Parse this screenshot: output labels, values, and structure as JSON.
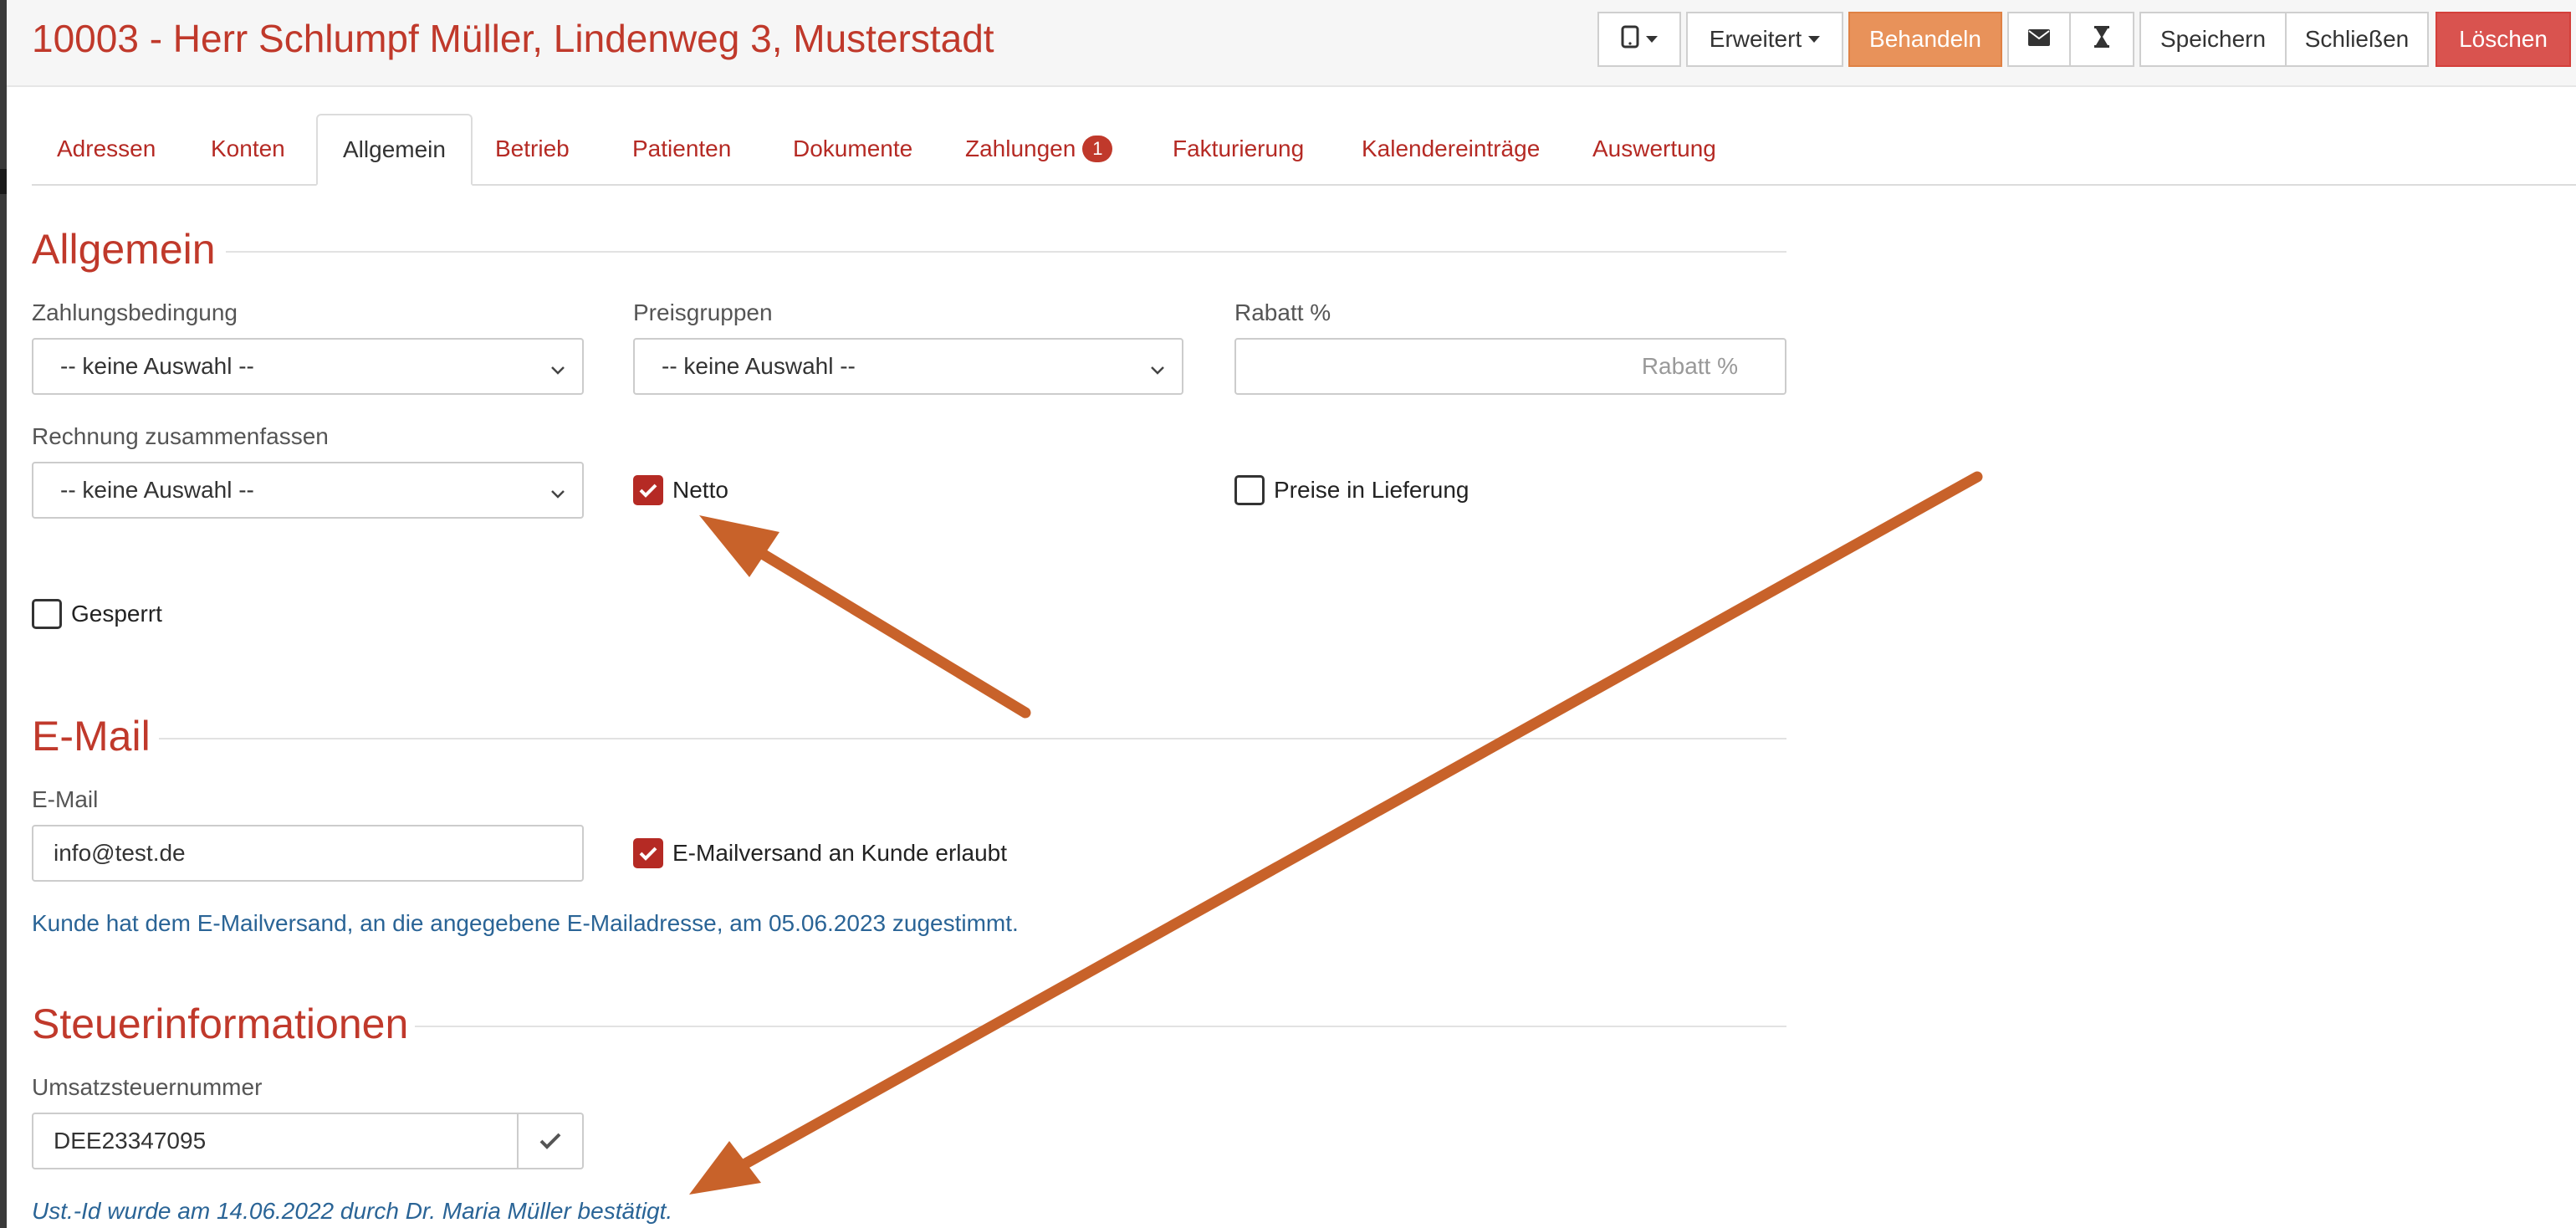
{
  "header": {
    "title": "10003 - Herr Schlumpf Müller, Lindenweg 3, Musterstadt",
    "buttons": {
      "device_icon": "tablet-icon",
      "erweitert": "Erweitert",
      "behandeln": "Behandeln",
      "mail_icon": "envelope-icon",
      "hourglass_icon": "hourglass-icon",
      "speichern": "Speichern",
      "schliessen": "Schließen",
      "loeschen": "Löschen"
    }
  },
  "tabs": [
    {
      "label": "Adressen"
    },
    {
      "label": "Konten"
    },
    {
      "label": "Allgemein",
      "active": true
    },
    {
      "label": "Betrieb"
    },
    {
      "label": "Patienten"
    },
    {
      "label": "Dokumente"
    },
    {
      "label": "Zahlungen",
      "badge": "1"
    },
    {
      "label": "Fakturierung"
    },
    {
      "label": "Kalendereinträge"
    },
    {
      "label": "Auswertung"
    }
  ],
  "allgemein": {
    "title": "Allgemein",
    "zahlungsbedingung": {
      "label": "Zahlungsbedingung",
      "value": "-- keine Auswahl --"
    },
    "preisgruppen": {
      "label": "Preisgruppen",
      "value": "-- keine Auswahl --"
    },
    "rabatt": {
      "label": "Rabatt %",
      "placeholder": "Rabatt %",
      "value": ""
    },
    "rechnung": {
      "label": "Rechnung zusammenfassen",
      "value": "-- keine Auswahl --"
    },
    "netto": {
      "label": "Netto",
      "checked": true
    },
    "preise_lieferung": {
      "label": "Preise in Lieferung",
      "checked": false
    },
    "gesperrt": {
      "label": "Gesperrt",
      "checked": false
    }
  },
  "email": {
    "title": "E-Mail",
    "field": {
      "label": "E-Mail",
      "value": "info@test.de"
    },
    "versand": {
      "label": "E-Mailversand an Kunde erlaubt",
      "checked": true
    },
    "consent_text": "Kunde hat dem E-Mailversand, an die angegebene E-Mailadresse, am 05.06.2023 zugestimmt."
  },
  "steuer": {
    "title": "Steuerinformationen",
    "ust": {
      "label": "Umsatzsteuernummer",
      "value": "DEE23347095",
      "verify_icon": "check-icon"
    },
    "confirm_text": "Ust.-Id wurde am 14.06.2022 durch Dr. Maria Müller bestätigt."
  },
  "colors": {
    "accent": "#c0392b",
    "behandeln": "#e8925a",
    "loeschen": "#d9534f",
    "info": "#2a6496",
    "annotation_arrow": "#c8622a"
  }
}
